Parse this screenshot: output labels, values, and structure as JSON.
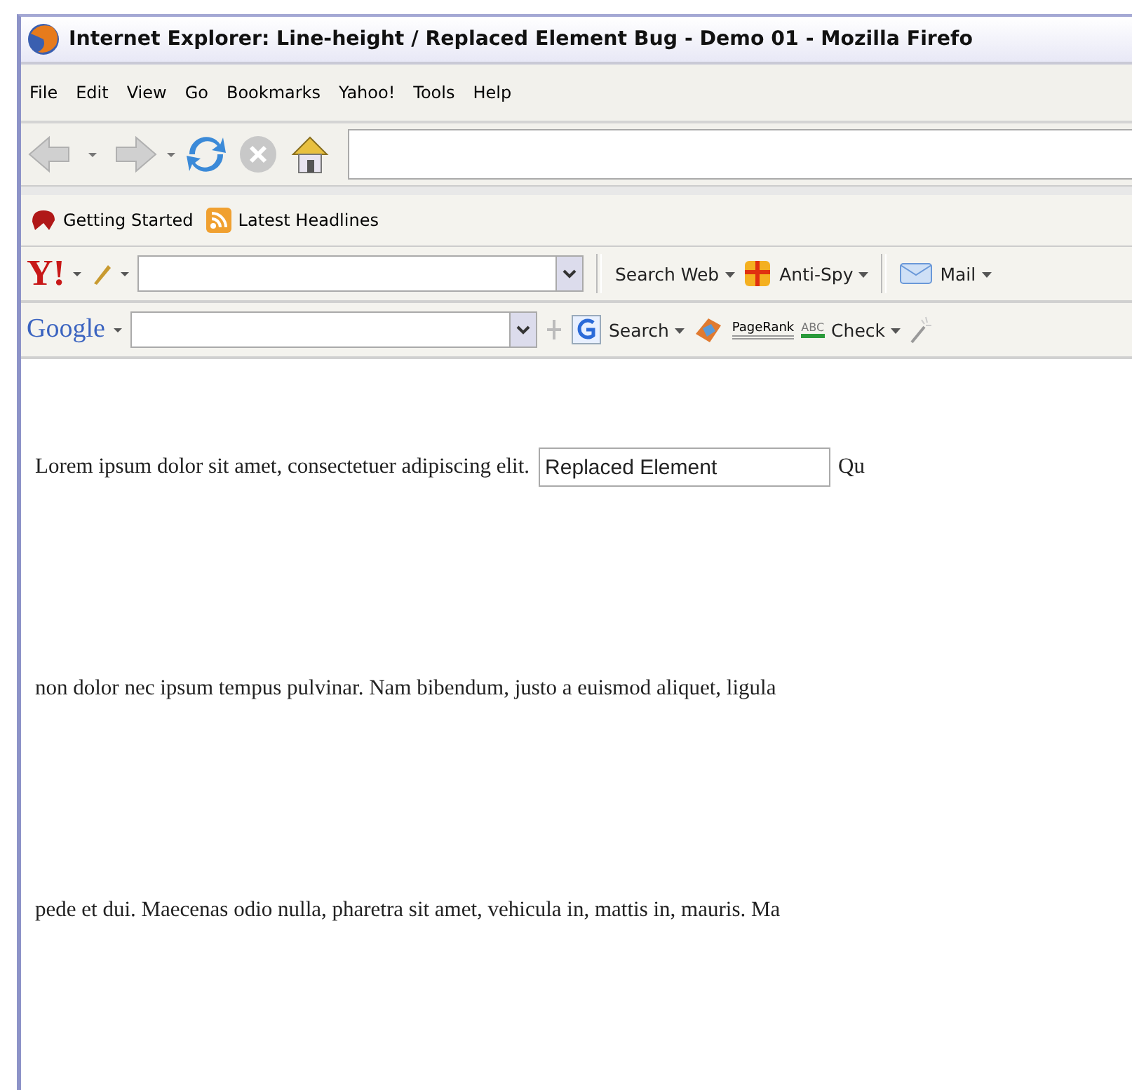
{
  "window": {
    "title": "Internet Explorer: Line-height / Replaced Element Bug - Demo 01 - Mozilla Firefo"
  },
  "menu": [
    "File",
    "Edit",
    "View",
    "Go",
    "Bookmarks",
    "Yahoo!",
    "Tools",
    "Help"
  ],
  "bookmarks": [
    "Getting Started",
    "Latest Headlines"
  ],
  "yahoo_toolbar": {
    "logo": "Y!",
    "search_button": "Search Web",
    "anti_spy": "Anti-Spy",
    "mail": "Mail"
  },
  "google_toolbar": {
    "logo": "Google",
    "search_button": "Search",
    "pagerank": "PageRank",
    "check_icon_label": "ABC",
    "check": "Check"
  },
  "content": {
    "lines": [
      {
        "text": "Lorem ipsum dolor sit amet, consectetuer adipiscing elit.",
        "field_value": "Replaced Element",
        "after": "Qu"
      },
      {
        "text": "non dolor nec ipsum tempus pulvinar. Nam bibendum, justo a euismod aliquet, ligula"
      },
      {
        "text": "pede et dui. Maecenas odio nulla, pharetra sit amet, vehicula in, mattis in, mauris. Ma"
      }
    ]
  }
}
